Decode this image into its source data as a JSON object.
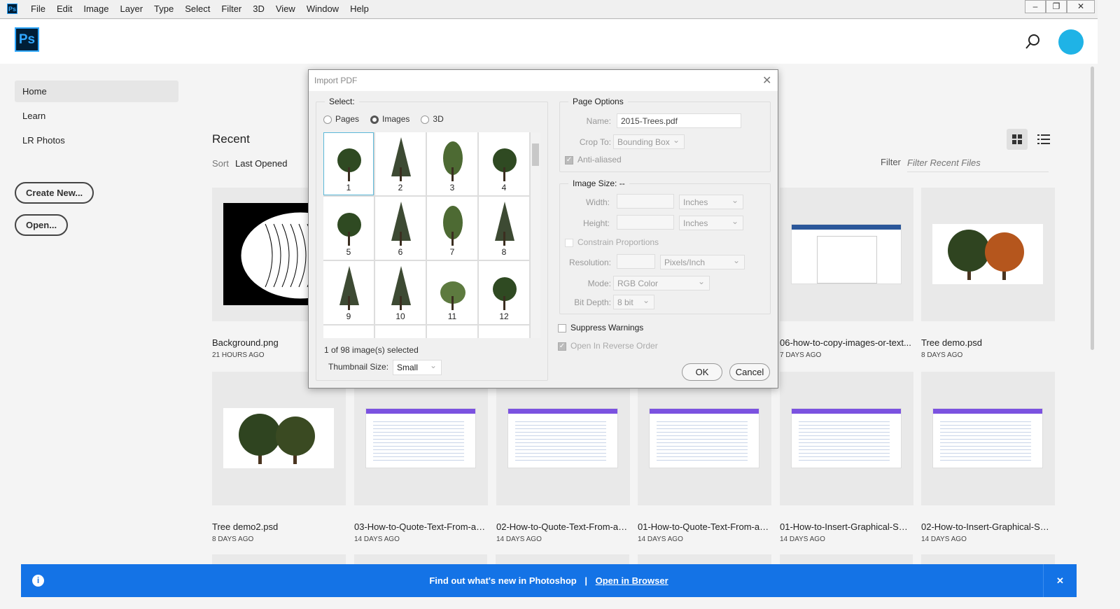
{
  "menubar": {
    "logo": "Ps",
    "items": [
      "File",
      "Edit",
      "Image",
      "Layer",
      "Type",
      "Select",
      "Filter",
      "3D",
      "View",
      "Window",
      "Help"
    ],
    "window_controls": [
      "minimize",
      "restore",
      "close"
    ]
  },
  "header": {
    "logo": "Ps",
    "search_icon": "search-icon",
    "accent": "#31a8ff"
  },
  "sidebar": {
    "items": [
      {
        "label": "Home",
        "active": true
      },
      {
        "label": "Learn"
      },
      {
        "label": "LR Photos"
      }
    ],
    "create_new": "Create New...",
    "open": "Open..."
  },
  "recent": {
    "title": "Recent",
    "sort_label": "Sort",
    "sort_value": "Last Opened",
    "filter_label": "Filter",
    "filter_placeholder": "Filter Recent Files",
    "row1": [
      {
        "name": "Background.png",
        "date": "21 HOURS AGO",
        "thumb": "fish"
      },
      {
        "name": "06-how-to-copy-images-or-text...",
        "date": "7 DAYS AGO",
        "thumb": "doc"
      },
      {
        "name": "Tree demo.psd",
        "date": "8 DAYS AGO",
        "thumb": "trees-autumn"
      }
    ],
    "row2": [
      {
        "name": "Tree demo2.psd",
        "date": "8 DAYS AGO",
        "thumb": "trees"
      },
      {
        "name": "03-How-to-Quote-Text-From-an...",
        "date": "14 DAYS AGO",
        "thumb": "web"
      },
      {
        "name": "02-How-to-Quote-Text-From-an...",
        "date": "14 DAYS AGO",
        "thumb": "web"
      },
      {
        "name": "01-How-to-Quote-Text-From-an...",
        "date": "14 DAYS AGO",
        "thumb": "web"
      },
      {
        "name": "01-How-to-Insert-Graphical-Smil...",
        "date": "14 DAYS AGO",
        "thumb": "web"
      },
      {
        "name": "02-How-to-Insert-Graphical-Smi...",
        "date": "14 DAYS AGO",
        "thumb": "web"
      }
    ]
  },
  "banner": {
    "text": "Find out what's new in Photoshop",
    "separator": "|",
    "link": "Open in Browser",
    "color": "#1473e6"
  },
  "dialog": {
    "title": "Import PDF",
    "select_legend": "Select:",
    "radios": [
      {
        "label": "Pages",
        "checked": false
      },
      {
        "label": "Images",
        "checked": true
      },
      {
        "label": "3D",
        "checked": false
      }
    ],
    "thumbnails": [
      "1",
      "2",
      "3",
      "4",
      "5",
      "6",
      "7",
      "8",
      "9",
      "10",
      "11",
      "12"
    ],
    "status": "1 of 98 image(s) selected",
    "thumb_size_label": "Thumbnail Size:",
    "thumb_size_value": "Small",
    "page_options": {
      "legend": "Page Options",
      "name_label": "Name:",
      "name_value": "2015-Trees.pdf",
      "crop_label": "Crop To:",
      "crop_value": "Bounding Box",
      "anti_aliased": "Anti-aliased"
    },
    "image_size": {
      "legend": "Image Size: --",
      "width_label": "Width:",
      "width_unit": "Inches",
      "height_label": "Height:",
      "height_unit": "Inches",
      "constrain": "Constrain Proportions",
      "resolution_label": "Resolution:",
      "resolution_unit": "Pixels/Inch",
      "mode_label": "Mode:",
      "mode_value": "RGB Color",
      "depth_label": "Bit Depth:",
      "depth_value": "8 bit"
    },
    "suppress_warnings": "Suppress Warnings",
    "reverse_order": "Open In Reverse Order",
    "ok": "OK",
    "cancel": "Cancel"
  }
}
